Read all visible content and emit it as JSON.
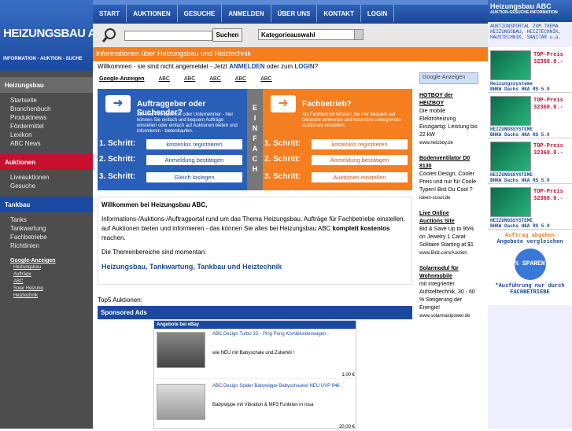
{
  "logo": {
    "title": "HEIZUNGSBAU ABC",
    "subtitle": "INFORMATION - AUKTION - SUCHE"
  },
  "topnav": [
    "START",
    "AUKTIONEN",
    "GESUCHE",
    "ANMELDEN",
    "ÜBER UNS",
    "KONTAKT",
    "LOGIN"
  ],
  "search": {
    "button": "Suchen",
    "category": "Kategorieauswahl"
  },
  "banner": "Informationen über Heizungsbau und Heiztechnik",
  "welcome_line": {
    "pre": "Willkommen - sie sind nicht angemeldet - Jetzt ",
    "anmelden": "ANMELDEN",
    "mid": " oder zum ",
    "login": "LOGIN",
    "post": "?"
  },
  "sidebar": {
    "s1": "Heizungsbau",
    "s1_items": [
      "Startseite",
      "Branchenbuch",
      "Produktnews",
      "Fördermittel",
      "Lexikon",
      "ABC News"
    ],
    "s2": "Auktionen",
    "s2_items": [
      "Liveauktionen",
      "Gesuche"
    ],
    "s3": "Tankbau",
    "s3_items": [
      "Tanks",
      "Tankwartung",
      "Fachbetriebe",
      "Richtlinien"
    ],
    "google_head": "Google-Anzeigen",
    "google_items": [
      "Heizungsbau",
      "Aufträge",
      "ABC",
      "Solar Heizung",
      "Heiztechnik"
    ]
  },
  "ads_row": [
    "Google-Anzeigen",
    "ABC",
    "ABC",
    "ABC",
    "ABC",
    "ABC"
  ],
  "steps_left": {
    "title": "Auftraggeber oder Suchender?",
    "desc": "Sie sind Privatperson oder Unternehmer - hier können Sie einfach und bequem Aufträge einstellen oder einfach auf Auktionen bieten und informieren - bietenkaufen.",
    "s1": "1. Schritt:",
    "b1": "kostenlos registrieren",
    "s2": "2. Schritt:",
    "b2": "Anmeldung bestätigen",
    "s3": "3. Schritt:",
    "b3": "Gleich loslegen"
  },
  "steps_mid": "EINFACH",
  "steps_right": {
    "title": "Fachbetrieb?",
    "desc": "Als Fachbetrieb können Sie hier bequem auf Gesuche antworten und kostenlos unbegrenzte Auktionen einstellen.",
    "s1": "1. Schritt:",
    "b1": "kostenlos registrieren",
    "s2": "2. Schritt:",
    "b2": "Anmeldung bestätigen",
    "s3": "3. Schritt:",
    "b3": "Auktionen einstellen"
  },
  "welcomebox": {
    "heading": "Willkommen bei Heizungsbau ABC,",
    "p1a": "Informations-/Auktions-/Auftragportal rund um das Thema Heizungsbau. Aufträge für Fachbetriebe einstellen, auf Auktionen bieten und informieren - das können Sie alles bei Heizungsbau ABC ",
    "p1b": "komplett kostenlos",
    "p1c": " machen.",
    "p2": "Die Themenbereiche sind momentan:",
    "themes": "Heizungsbau, Tankwartung, Tankbau und Heiztechnik"
  },
  "top5": "Top5 Auktionen:",
  "sponsored": "Sponsored Ads",
  "ebay": {
    "header": "Angebote bei eBay",
    "items": [
      {
        "title": "ABC Design Turbo 3S - Ping Pong Kombikinderwagen -",
        "desc": "wie NEU mit Babyschale und Zubehör !",
        "price": "1,00 €"
      },
      {
        "title": "ABC Design Spider Babywippe Babyschaukel NEU UVP 94€",
        "desc": "Babywippe mit Vibration & MP3 Funktion in rosa",
        "price": "20,00 €"
      }
    ]
  },
  "google_col": {
    "label": "Google-Anzeigen",
    "ads": [
      {
        "h1": "HOTBOY der",
        "h2": "HEIZBOY",
        "body": "Die mobile Elektroheizung Einzigartig: Leistung bis 22 kW",
        "url": "www.heizboy.de"
      },
      {
        "h1": "Bodenventilator D0",
        "h2": "8130",
        "body": "Cooles Design, Cooler Preis und nur für Coole Typen! Bist Du Cool ?",
        "url": "ideen-scout.de"
      },
      {
        "h1": "Live Online",
        "h2": "Auctions Site",
        "body": "Bid & Save Up to 95% on Jewelry 1 Carat Solitaire Starting at $1",
        "url": "www.Bidz.com/Auction"
      },
      {
        "h1": "Solarmodul für",
        "h2": "Wohnmobile",
        "body": "mit integrierter Aufstelltechnik, 30 - 60 % Steigerung der Energie!",
        "url": "www.solarmaxipower.de"
      }
    ]
  },
  "right": {
    "title": "Heizungsbau ABC",
    "sub": "AUKTION-GESUCHE-INFORMATION",
    "desc": "AUKTIONSPORTAL ZUM THEMA HEIZUNGSBAU, HEIZTECHNIK, HAUSTECHNIK, SANITÄR u.a.",
    "promos": [
      {
        "t1": "TOP-Preis",
        "t2": "32368.0.-",
        "n1": "Heizungssysteme",
        "n2": "BHKW Dachs HKA RS 5.0"
      },
      {
        "t1": "TOP-Preis",
        "t2": "32368.0.-",
        "n1": "HEIZUNGSSYSTEME",
        "n2": "BHKW Dachs HKA RS 5.0"
      },
      {
        "t1": "TOP-Preis",
        "t2": "32368.0.-",
        "n1": "HEIZUNGSSYSTEME",
        "n2": "BHKW Dachs HKA RS 5.0"
      },
      {
        "t1": "TOP-Preis",
        "t2": "32368.0.-",
        "n1": "HEIZUNGSSYSTEME",
        "n2": "BHKW Dachs HKA RS 5.0"
      }
    ],
    "auftrag": {
      "l1": "Auftrag abgeben",
      "l2": "Angebote vergleichen",
      "seal": "% SPAREN",
      "l3": "*Ausführung nur durch",
      "l4": "FACHBETRIEBE"
    }
  }
}
